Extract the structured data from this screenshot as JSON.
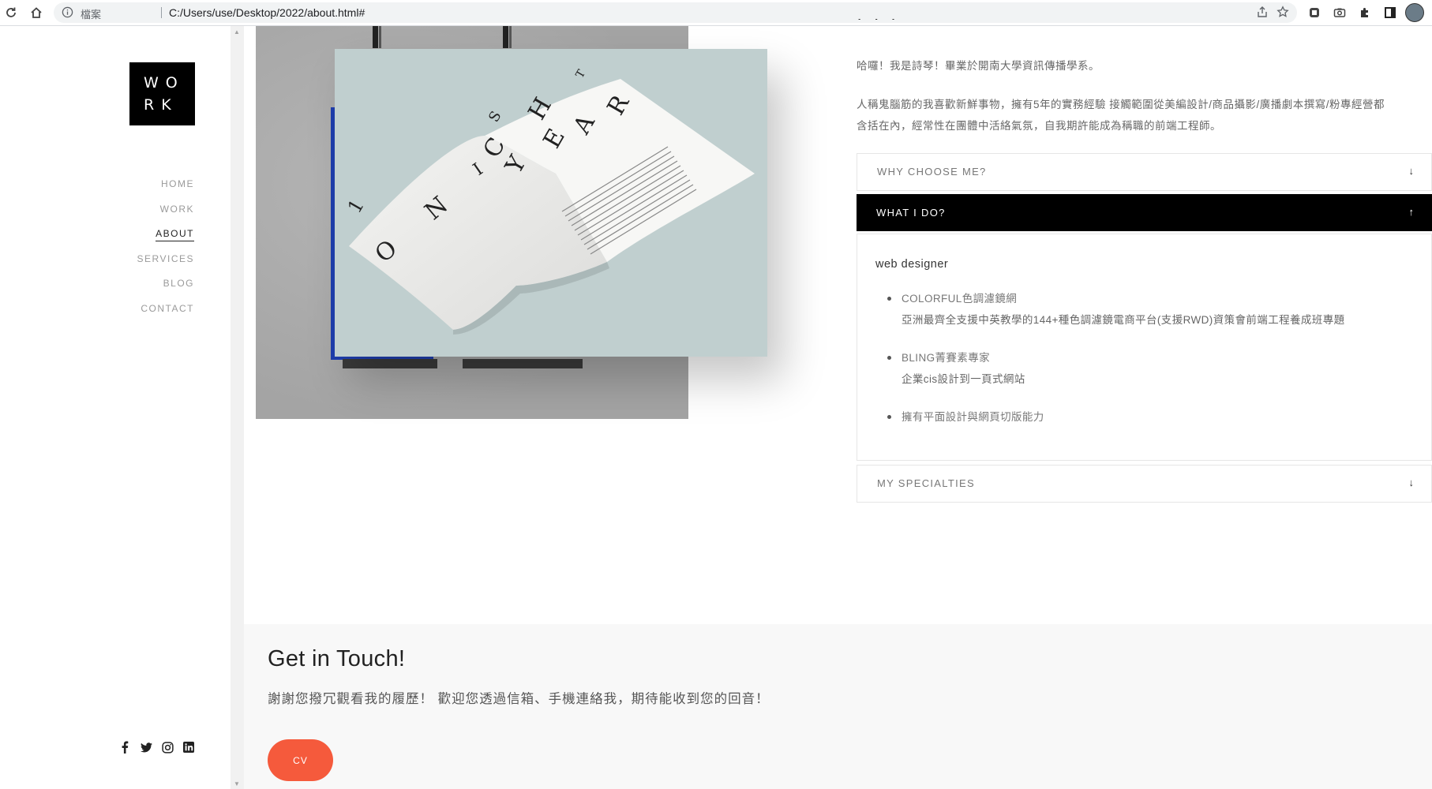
{
  "browser": {
    "scheme_label": "檔案",
    "url": "C:/Users/use/Desktop/2022/about.html#"
  },
  "sidebar": {
    "logo_line1": "WO",
    "logo_line2": "RK",
    "menu": [
      {
        "label": "HOME"
      },
      {
        "label": "WORK"
      },
      {
        "label": "ABOUT",
        "active": true
      },
      {
        "label": "SERVICES"
      },
      {
        "label": "BLOG"
      },
      {
        "label": "CONTACT"
      }
    ],
    "social": [
      "facebook-icon",
      "twitter-icon",
      "instagram-icon",
      "linkedin-icon"
    ]
  },
  "mockup": {
    "letters": [
      "O",
      "N",
      "I",
      "C",
      "H",
      "S",
      "T",
      "Y",
      "E",
      "A",
      "R",
      "1"
    ]
  },
  "about": {
    "para1": "哈囉！我是詩琴！畢業於開南大學資訊傳播學系。",
    "para2_line1": "人稱鬼腦筋的我喜歡新鮮事物，擁有5年的實務經驗 接觸範圍從美編設計/商品攝影/廣播劇本撰寫/粉專經營都",
    "para2_line2": "含括在內，經常性在團體中活絡氣氛，自我期許能成為稱職的前端工程師。"
  },
  "accordion": [
    {
      "title": "WHY CHOOSE ME?",
      "arrow": "↓",
      "open": false
    },
    {
      "title": "WHAT I DO?",
      "arrow": "↑",
      "open": true
    },
    {
      "title": "MY SPECIALTIES",
      "arrow": "↓",
      "open": false
    }
  ],
  "what_i_do": {
    "role": "web designer",
    "items": [
      {
        "title": "COLORFUL色調濾鏡網",
        "desc": "亞洲最齊全支援中英教學的144+種色調濾鏡電商平台(支援RWD)資策會前端工程養成班專題"
      },
      {
        "title": "BLING菁賽素專家",
        "desc": "企業cis設計到一頁式網站"
      },
      {
        "title": "擁有平面設計與網頁切版能力",
        "desc": ""
      }
    ]
  },
  "contact": {
    "heading": "Get in Touch!",
    "text": "謝謝您撥冗觀看我的履歷！ 歡迎您透過信箱、手機連絡我，期待能收到您的回音！",
    "cv_label": "CV"
  }
}
